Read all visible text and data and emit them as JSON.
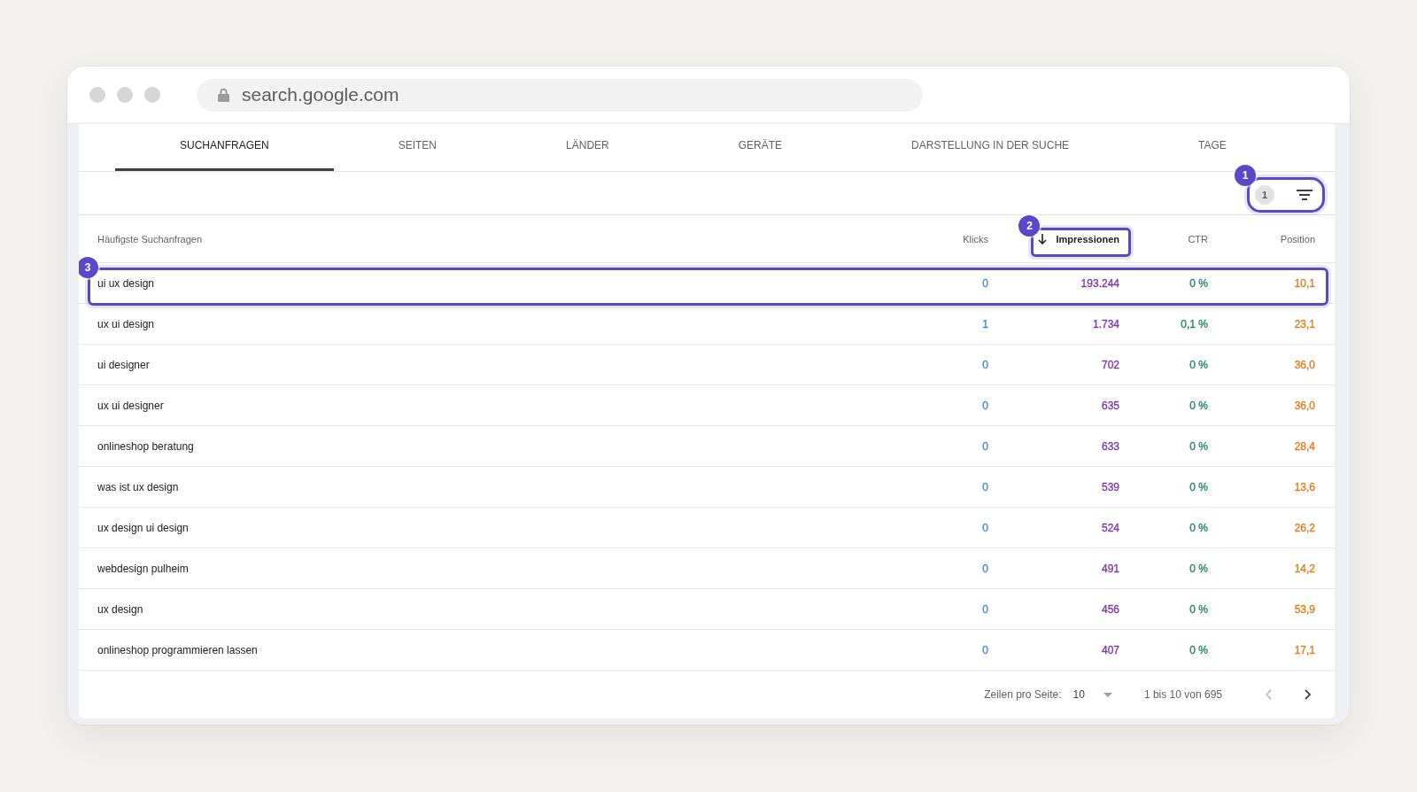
{
  "browser": {
    "url": "search.google.com"
  },
  "tabs": [
    {
      "label": "SUCHANFRAGEN",
      "selected": true
    },
    {
      "label": "SEITEN",
      "selected": false
    },
    {
      "label": "LÄNDER",
      "selected": false
    },
    {
      "label": "GERÄTE",
      "selected": false
    },
    {
      "label": "DARSTELLUNG IN DER SUCHE",
      "selected": false
    },
    {
      "label": "TAGE",
      "selected": false
    }
  ],
  "filter": {
    "active_count": "1",
    "callout": "1"
  },
  "table": {
    "columns": [
      {
        "label": "Häufigste Suchanfragen",
        "sorted": false
      },
      {
        "label": "Klicks",
        "sorted": false,
        "color": "#4a88d6"
      },
      {
        "label": "Impressionen",
        "sorted": true,
        "color": "#7e3aab",
        "callout": "2"
      },
      {
        "label": "CTR",
        "sorted": false,
        "color": "#21896b"
      },
      {
        "label": "Position",
        "sorted": false,
        "color": "#e47d1c"
      }
    ],
    "rows": [
      {
        "cells": [
          "ui ux design",
          "0",
          "193.244",
          "0 %",
          "10,1"
        ],
        "callout": "3"
      },
      {
        "cells": [
          "ux ui design",
          "1",
          "1.734",
          "0,1 %",
          "23,1"
        ]
      },
      {
        "cells": [
          "ui designer",
          "0",
          "702",
          "0 %",
          "36,0"
        ]
      },
      {
        "cells": [
          "ux ui designer",
          "0",
          "635",
          "0 %",
          "36,0"
        ]
      },
      {
        "cells": [
          "onlineshop beratung",
          "0",
          "633",
          "0 %",
          "28,4"
        ]
      },
      {
        "cells": [
          "was ist ux design",
          "0",
          "539",
          "0 %",
          "13,6"
        ]
      },
      {
        "cells": [
          "ux design ui design",
          "0",
          "524",
          "0 %",
          "26,2"
        ]
      },
      {
        "cells": [
          "webdesign pulheim",
          "0",
          "491",
          "0 %",
          "14,2"
        ]
      },
      {
        "cells": [
          "ux design",
          "0",
          "456",
          "0 %",
          "53,9"
        ]
      },
      {
        "cells": [
          "onlineshop programmieren lassen",
          "0",
          "407",
          "0 %",
          "17,1"
        ]
      }
    ]
  },
  "pagination": {
    "rows_per_page_label": "Zeilen pro Seite:",
    "rows_per_page": "10",
    "range": "1 bis 10 von 695",
    "previous": {
      "disabled": true
    },
    "next": {
      "disabled": false
    }
  }
}
